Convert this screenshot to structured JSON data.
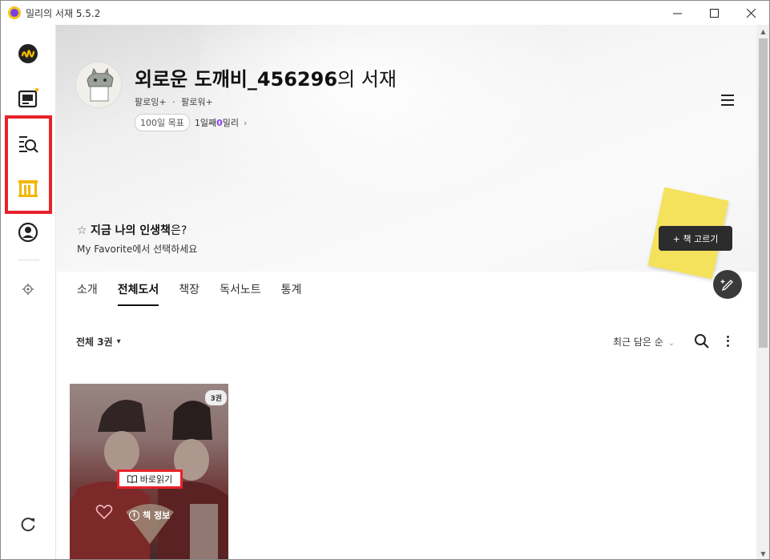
{
  "window": {
    "title": "밀리의 서재 5.5.2",
    "controls": [
      "minimize",
      "maximize",
      "close"
    ]
  },
  "sidebar": {
    "items": [
      {
        "name": "home",
        "icon": "millie-logo-icon"
      },
      {
        "name": "viewer",
        "icon": "tablet-icon",
        "has_notification": true
      },
      {
        "name": "search",
        "icon": "list-search-icon",
        "highlighted": true
      },
      {
        "name": "library",
        "icon": "bookshelf-icon",
        "active": true,
        "highlighted": true
      },
      {
        "name": "profile",
        "icon": "user-circle-icon"
      },
      {
        "name": "settings",
        "icon": "gear-icon"
      },
      {
        "name": "refresh",
        "icon": "refresh-icon"
      }
    ],
    "accent_color": "#f2b705",
    "highlight_color": "#e8222a"
  },
  "profile": {
    "name": "외로운 도깨비_456296",
    "suffix": "의 서재",
    "following": "팔로잉+",
    "separator": "·",
    "followers": "팔로워+",
    "goal_label": "100일 목표",
    "goal_progress_prefix": "1일째 ",
    "goal_progress_count": "0",
    "goal_progress_suffix": "밀리",
    "goal_arrow": "›"
  },
  "life_book": {
    "star": "☆",
    "title_bold": "지금 나의 인생책",
    "title_rest": "은?",
    "subtitle": "My Favorite에서 선택하세요",
    "choose_button": "+ 책 고르기"
  },
  "tabs": [
    {
      "label": "소개",
      "active": false
    },
    {
      "label": "전체도서",
      "active": true
    },
    {
      "label": "책장",
      "active": false
    },
    {
      "label": "독서노트",
      "active": false
    },
    {
      "label": "통계",
      "active": false
    }
  ],
  "filter": {
    "count_label": "전체 3권",
    "count_caret": "▾",
    "sort_label": "최근 담은 순",
    "sort_caret": "⌄"
  },
  "book": {
    "count_badge": "3권",
    "read_button": "바로읽기",
    "info_button": "책 정보",
    "info_glyph": "i"
  },
  "colors": {
    "goal_highlight": "#8b3cf0",
    "sticky_note": "#f5e25c",
    "dark_button": "#2c2c2c"
  }
}
